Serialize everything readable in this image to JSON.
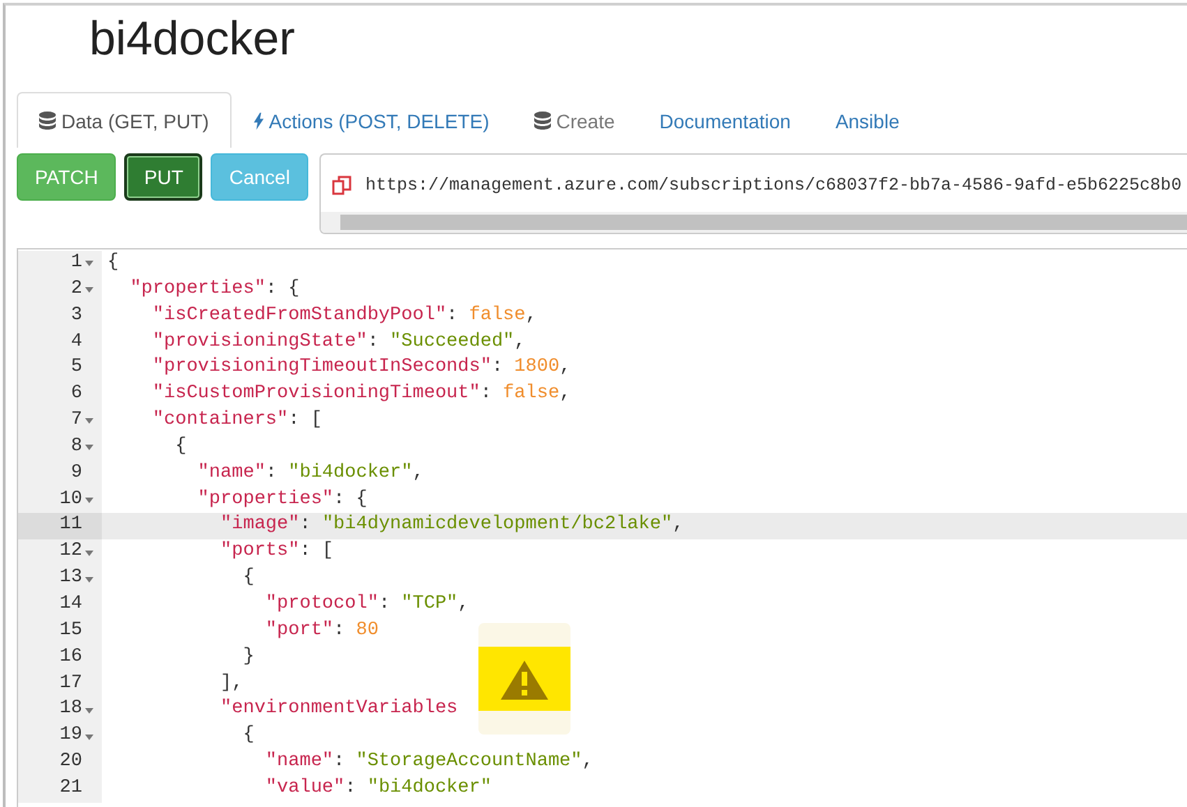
{
  "title": "bi4docker",
  "tabs": [
    {
      "label": "Data (GET, PUT)",
      "kind": "data",
      "selected": true,
      "disabled": false
    },
    {
      "label": "Actions (POST, DELETE)",
      "kind": "action",
      "selected": false,
      "disabled": false
    },
    {
      "label": "Create",
      "kind": "data",
      "selected": false,
      "disabled": true
    },
    {
      "label": "Documentation",
      "kind": "text",
      "selected": false,
      "disabled": false
    },
    {
      "label": "Ansible",
      "kind": "text",
      "selected": false,
      "disabled": false
    }
  ],
  "buttons": [
    {
      "label": "PATCH",
      "kind": "success",
      "selected": false
    },
    {
      "label": "PUT",
      "kind": "success",
      "selected": true
    },
    {
      "label": "Cancel",
      "kind": "info",
      "selected": false
    }
  ],
  "url": "https://management.azure.com/subscriptions/c68037f2-bb7a-4586-9afd-e5b6225c8b0",
  "editor": {
    "lines": [
      {
        "number": "1",
        "fold": true,
        "current": false,
        "tokens": [
          {
            "kind": "punct",
            "text": "{"
          }
        ]
      },
      {
        "number": "2",
        "fold": true,
        "current": false,
        "tokens": [
          {
            "kind": "key",
            "text": "  \"properties\""
          },
          {
            "kind": "punct",
            "text": ": {"
          }
        ]
      },
      {
        "number": "3",
        "fold": false,
        "current": false,
        "tokens": [
          {
            "kind": "key",
            "text": "    \"isCreatedFromStandbyPool\""
          },
          {
            "kind": "punct",
            "text": ": "
          },
          {
            "kind": "literal",
            "text": "false"
          },
          {
            "kind": "punct",
            "text": ","
          }
        ]
      },
      {
        "number": "4",
        "fold": false,
        "current": false,
        "tokens": [
          {
            "kind": "key",
            "text": "    \"provisioningState\""
          },
          {
            "kind": "punct",
            "text": ": "
          },
          {
            "kind": "string",
            "text": "\"Succeeded\""
          },
          {
            "kind": "punct",
            "text": ","
          }
        ]
      },
      {
        "number": "5",
        "fold": false,
        "current": false,
        "tokens": [
          {
            "kind": "key",
            "text": "    \"provisioningTimeoutInSeconds\""
          },
          {
            "kind": "punct",
            "text": ": "
          },
          {
            "kind": "literal",
            "text": "1800"
          },
          {
            "kind": "punct",
            "text": ","
          }
        ]
      },
      {
        "number": "6",
        "fold": false,
        "current": false,
        "tokens": [
          {
            "kind": "key",
            "text": "    \"isCustomProvisioningTimeout\""
          },
          {
            "kind": "punct",
            "text": ": "
          },
          {
            "kind": "literal",
            "text": "false"
          },
          {
            "kind": "punct",
            "text": ","
          }
        ]
      },
      {
        "number": "7",
        "fold": true,
        "current": false,
        "tokens": [
          {
            "kind": "key",
            "text": "    \"containers\""
          },
          {
            "kind": "punct",
            "text": ": ["
          }
        ]
      },
      {
        "number": "8",
        "fold": true,
        "current": false,
        "tokens": [
          {
            "kind": "punct",
            "text": "      {"
          }
        ]
      },
      {
        "number": "9",
        "fold": false,
        "current": false,
        "tokens": [
          {
            "kind": "key",
            "text": "        \"name\""
          },
          {
            "kind": "punct",
            "text": ": "
          },
          {
            "kind": "string",
            "text": "\"bi4docker\""
          },
          {
            "kind": "punct",
            "text": ","
          }
        ]
      },
      {
        "number": "10",
        "fold": true,
        "current": false,
        "tokens": [
          {
            "kind": "key",
            "text": "        \"properties\""
          },
          {
            "kind": "punct",
            "text": ": {"
          }
        ]
      },
      {
        "number": "11",
        "fold": false,
        "current": true,
        "tokens": [
          {
            "kind": "key",
            "text": "          \"image\""
          },
          {
            "kind": "punct",
            "text": ": "
          },
          {
            "kind": "string",
            "text": "\"bi4dynamicdevelopment/bc2lake\""
          },
          {
            "kind": "punct",
            "text": ","
          }
        ]
      },
      {
        "number": "12",
        "fold": true,
        "current": false,
        "tokens": [
          {
            "kind": "key",
            "text": "          \"ports\""
          },
          {
            "kind": "punct",
            "text": ": ["
          }
        ]
      },
      {
        "number": "13",
        "fold": true,
        "current": false,
        "tokens": [
          {
            "kind": "punct",
            "text": "            {"
          }
        ]
      },
      {
        "number": "14",
        "fold": false,
        "current": false,
        "tokens": [
          {
            "kind": "key",
            "text": "              \"protocol\""
          },
          {
            "kind": "punct",
            "text": ": "
          },
          {
            "kind": "string",
            "text": "\"TCP\""
          },
          {
            "kind": "punct",
            "text": ","
          }
        ]
      },
      {
        "number": "15",
        "fold": false,
        "current": false,
        "tokens": [
          {
            "kind": "key",
            "text": "              \"port\""
          },
          {
            "kind": "punct",
            "text": ": "
          },
          {
            "kind": "literal",
            "text": "80"
          }
        ]
      },
      {
        "number": "16",
        "fold": false,
        "current": false,
        "tokens": [
          {
            "kind": "punct",
            "text": "            }"
          }
        ]
      },
      {
        "number": "17",
        "fold": false,
        "current": false,
        "tokens": [
          {
            "kind": "punct",
            "text": "          ],"
          }
        ]
      },
      {
        "number": "18",
        "fold": true,
        "current": false,
        "tokens": [
          {
            "kind": "key",
            "text": "          \"environmentVariables"
          }
        ]
      },
      {
        "number": "19",
        "fold": true,
        "current": false,
        "tokens": [
          {
            "kind": "punct",
            "text": "            {"
          }
        ]
      },
      {
        "number": "20",
        "fold": false,
        "current": false,
        "tokens": [
          {
            "kind": "key",
            "text": "              \"name\""
          },
          {
            "kind": "punct",
            "text": ": "
          },
          {
            "kind": "string",
            "text": "\"StorageAccountName\""
          },
          {
            "kind": "punct",
            "text": ","
          }
        ]
      },
      {
        "number": "21",
        "fold": false,
        "current": false,
        "tokens": [
          {
            "kind": "key",
            "text": "              \"value\""
          },
          {
            "kind": "punct",
            "text": ": "
          },
          {
            "kind": "string",
            "text": "\"bi4docker\""
          }
        ]
      }
    ]
  },
  "warning": {
    "kind": "warning"
  }
}
